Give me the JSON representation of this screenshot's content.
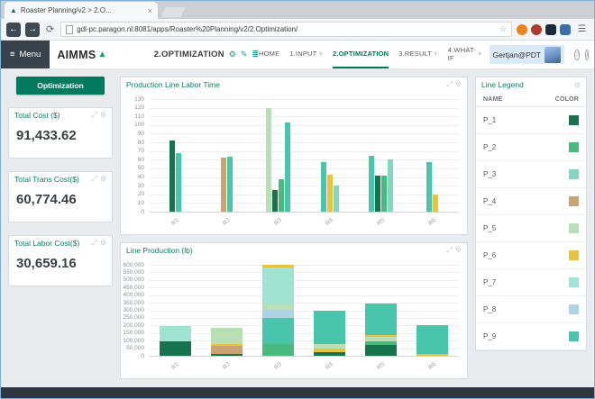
{
  "browser": {
    "tab_title": "Roaster Planning/v2 > 2.O...",
    "url": "gdl-pc.paragon.nl:8081/apps/Roaster%20Planning/v2/2.Optimization/"
  },
  "icons": {
    "menu": "≡",
    "gear": "⚙",
    "pencil": "✎",
    "list": "≣",
    "expand": "⤢",
    "caret": "∨",
    "close": "×",
    "back": "←",
    "forward": "→",
    "refresh": "⟳",
    "star": "☆",
    "browser_menu": "☰",
    "info": "i",
    "help": "?",
    "logo_triangle": "▲"
  },
  "header": {
    "menu_label": "Menu",
    "logo": "AIMMS",
    "page_title": "2.OPTIMIZATION",
    "nav": [
      {
        "label": "HOME",
        "caret": false,
        "active": false
      },
      {
        "label": "1.INPUT",
        "caret": true,
        "active": false
      },
      {
        "label": "2.OPTIMIZATION",
        "caret": false,
        "active": true
      },
      {
        "label": "3.RESULT",
        "caret": true,
        "active": false
      },
      {
        "label": "4.WHAT-IF",
        "caret": true,
        "active": false
      }
    ],
    "user": "Gertjan@PDT"
  },
  "sidebar": {
    "active_page_button": "Optimization",
    "stats": [
      {
        "title": "Total Cost ($)",
        "value": "91,433.62"
      },
      {
        "title": "Total Trans Cost($)",
        "value": "60,774.46"
      },
      {
        "title": "Total Labor Cost($)",
        "value": "30,659.16"
      }
    ]
  },
  "legend": {
    "title": "Line Legend",
    "columns": [
      "NAME",
      "COLOR"
    ],
    "items": [
      {
        "name": "P_1",
        "color": "#17734d"
      },
      {
        "name": "P_2",
        "color": "#49b97e"
      },
      {
        "name": "P_3",
        "color": "#83d7c0"
      },
      {
        "name": "P_4",
        "color": "#c9a373"
      },
      {
        "name": "P_5",
        "color": "#b9dfb4"
      },
      {
        "name": "P_6",
        "color": "#e7c33f"
      },
      {
        "name": "P_7",
        "color": "#9fe3d3"
      },
      {
        "name": "P_8",
        "color": "#aed4e4"
      },
      {
        "name": "P_9",
        "color": "#49c5ac"
      }
    ]
  },
  "chart_data": [
    {
      "type": "bar",
      "title": "Production Line Labor Time",
      "categories": [
        "R1",
        "R2",
        "R3",
        "R4",
        "R5",
        "R6"
      ],
      "ylabel": "",
      "xlabel": "",
      "ylim": [
        0,
        130
      ],
      "ystep": 10,
      "grid": true,
      "groups": {
        "R1": [
          {
            "product": "P_1",
            "value": 82
          },
          {
            "product": "P_9",
            "value": 68
          }
        ],
        "R2": [
          {
            "product": "P_4",
            "value": 62
          },
          {
            "product": "P_9",
            "value": 63
          }
        ],
        "R3": [
          {
            "product": "P_5",
            "value": 120
          },
          {
            "product": "P_1",
            "value": 25
          },
          {
            "product": "P_2",
            "value": 37
          },
          {
            "product": "P_9",
            "value": 103
          }
        ],
        "R4": [
          {
            "product": "P_9",
            "value": 57
          },
          {
            "product": "P_6",
            "value": 43
          },
          {
            "product": "P_3",
            "value": 30
          }
        ],
        "R5": [
          {
            "product": "P_9",
            "value": 65
          },
          {
            "product": "P_1",
            "value": 42
          },
          {
            "product": "P_2",
            "value": 42
          },
          {
            "product": "P_3",
            "value": 60
          }
        ],
        "R6": [
          {
            "product": "P_9",
            "value": 57
          },
          {
            "product": "P_6",
            "value": 20
          }
        ]
      }
    },
    {
      "type": "stacked-bar",
      "title": "Line Production (lb)",
      "categories": [
        "R1",
        "R2",
        "R3",
        "R4",
        "R5",
        "R6"
      ],
      "ylabel": "",
      "xlabel": "",
      "ylim": [
        0,
        600000
      ],
      "ystep": 50000,
      "grid": true,
      "stacks": {
        "R1": [
          {
            "product": "P_1",
            "value": 95000
          },
          {
            "product": "P_7",
            "value": 100000
          }
        ],
        "R2": [
          {
            "product": "P_1",
            "value": 12000
          },
          {
            "product": "P_4",
            "value": 55000
          },
          {
            "product": "P_6",
            "value": 8000
          },
          {
            "product": "P_5",
            "value": 110000
          }
        ],
        "R3": [
          {
            "product": "P_2",
            "value": 80000
          },
          {
            "product": "P_9",
            "value": 170000
          },
          {
            "product": "P_8",
            "value": 55000
          },
          {
            "product": "P_5",
            "value": 35000
          },
          {
            "product": "P_7",
            "value": 240000
          },
          {
            "product": "P_6",
            "value": 20000
          }
        ],
        "R4": [
          {
            "product": "P_1",
            "value": 25000
          },
          {
            "product": "P_6",
            "value": 20000
          },
          {
            "product": "P_5",
            "value": 35000
          },
          {
            "product": "P_9",
            "value": 215000
          }
        ],
        "R5": [
          {
            "product": "P_1",
            "value": 70000
          },
          {
            "product": "P_2",
            "value": 25000
          },
          {
            "product": "P_5",
            "value": 30000
          },
          {
            "product": "P_6",
            "value": 10000
          },
          {
            "product": "P_9",
            "value": 210000
          }
        ],
        "R6": [
          {
            "product": "P_6",
            "value": 12000
          },
          {
            "product": "P_9",
            "value": 193000
          }
        ]
      }
    }
  ],
  "extensions": [
    {
      "name": "extension-orange",
      "color": "#f0821e",
      "round": true
    },
    {
      "name": "extension-red",
      "color": "#b03a2e",
      "round": true
    },
    {
      "name": "extension-dark",
      "color": "#1b2a38",
      "round": false
    },
    {
      "name": "extension-blue",
      "color": "#3a6ea8",
      "round": false
    }
  ]
}
